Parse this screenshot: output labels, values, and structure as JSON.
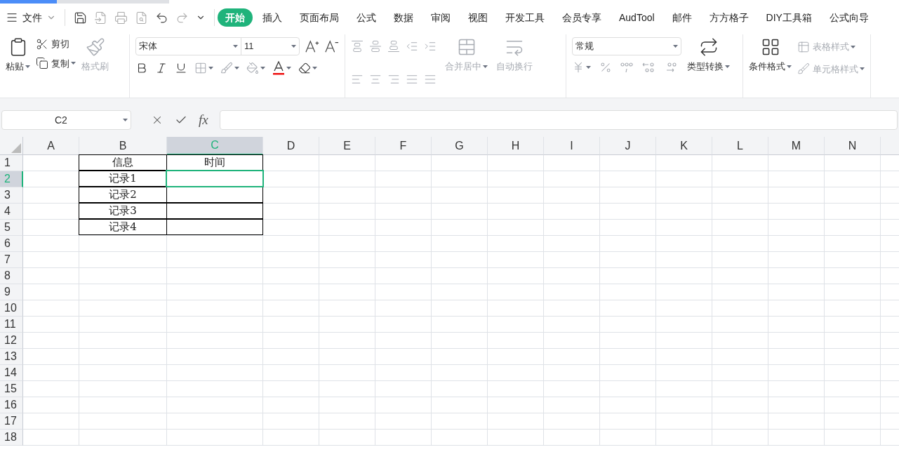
{
  "menu": {
    "file_label": "文件",
    "tabs": [
      {
        "label": "开始",
        "selected": true
      },
      {
        "label": "插入",
        "selected": false
      },
      {
        "label": "页面布局",
        "selected": false
      },
      {
        "label": "公式",
        "selected": false
      },
      {
        "label": "数据",
        "selected": false
      },
      {
        "label": "审阅",
        "selected": false
      },
      {
        "label": "视图",
        "selected": false
      },
      {
        "label": "开发工具",
        "selected": false
      },
      {
        "label": "会员专享",
        "selected": false
      },
      {
        "label": "AudTool",
        "selected": false
      },
      {
        "label": "邮件",
        "selected": false
      },
      {
        "label": "方方格子",
        "selected": false
      },
      {
        "label": "DIY工具箱",
        "selected": false
      },
      {
        "label": "公式向导",
        "selected": false
      }
    ]
  },
  "ribbon": {
    "clipboard": {
      "paste": {
        "label": "粘贴",
        "disabled": false
      },
      "cut": {
        "label": "剪切",
        "disabled": false
      },
      "copy": {
        "label": "复制",
        "disabled": false
      },
      "format_painter": {
        "label": "格式刷",
        "disabled": true
      }
    },
    "font": {
      "name": "宋体",
      "size": "11"
    },
    "alignment": {
      "merge": {
        "label": "合并居中",
        "disabled": true
      },
      "wrap": {
        "label": "自动换行",
        "disabled": true
      }
    },
    "number": {
      "format": "常规",
      "convert": {
        "label": "类型转换",
        "disabled": false
      }
    },
    "styles": {
      "conditional": {
        "label": "条件格式",
        "disabled": false
      },
      "table_style": {
        "label": "表格样式",
        "disabled": true
      },
      "cell_style": {
        "label": "单元格样式",
        "disabled": true
      }
    }
  },
  "name_box": "C2",
  "formula_bar": {
    "fx_label": "fx"
  },
  "sheet": {
    "columns": [
      {
        "label": "A",
        "selected": false
      },
      {
        "label": "B",
        "selected": false
      },
      {
        "label": "C",
        "selected": true
      },
      {
        "label": "D",
        "selected": false
      },
      {
        "label": "E",
        "selected": false
      },
      {
        "label": "F",
        "selected": false
      },
      {
        "label": "G",
        "selected": false
      },
      {
        "label": "H",
        "selected": false
      },
      {
        "label": "I",
        "selected": false
      },
      {
        "label": "J",
        "selected": false
      },
      {
        "label": "K",
        "selected": false
      },
      {
        "label": "L",
        "selected": false
      },
      {
        "label": "M",
        "selected": false
      },
      {
        "label": "N",
        "selected": false
      }
    ],
    "rows": [
      {
        "label": "1",
        "selected": false,
        "cells": [
          {
            "bordered": false,
            "selected": false
          },
          {
            "text": "信息",
            "bordered": true,
            "selected": false
          },
          {
            "text": "时间",
            "bordered": true,
            "selected": false
          }
        ]
      },
      {
        "label": "2",
        "selected": true,
        "cells": [
          {
            "bordered": false,
            "selected": false
          },
          {
            "text": "记录1",
            "bordered": true,
            "selected": false
          },
          {
            "bordered": true,
            "selected": true
          }
        ]
      },
      {
        "label": "3",
        "selected": false,
        "cells": [
          {
            "bordered": false,
            "selected": false
          },
          {
            "text": "记录2",
            "bordered": true,
            "selected": false
          },
          {
            "bordered": true,
            "selected": false
          }
        ]
      },
      {
        "label": "4",
        "selected": false,
        "cells": [
          {
            "bordered": false,
            "selected": false
          },
          {
            "text": "记录3",
            "bordered": true,
            "selected": false
          },
          {
            "bordered": true,
            "selected": false
          }
        ]
      },
      {
        "label": "5",
        "selected": false,
        "cells": [
          {
            "bordered": false,
            "selected": false
          },
          {
            "text": "记录4",
            "bordered": true,
            "selected": false
          },
          {
            "bordered": true,
            "selected": false
          }
        ]
      },
      {
        "label": "6",
        "selected": false,
        "cells": []
      },
      {
        "label": "7",
        "selected": false,
        "cells": []
      },
      {
        "label": "8",
        "selected": false,
        "cells": []
      },
      {
        "label": "9",
        "selected": false,
        "cells": []
      },
      {
        "label": "10",
        "selected": false,
        "cells": []
      },
      {
        "label": "11",
        "selected": false,
        "cells": []
      },
      {
        "label": "12",
        "selected": false,
        "cells": []
      },
      {
        "label": "13",
        "selected": false,
        "cells": []
      },
      {
        "label": "14",
        "selected": false,
        "cells": []
      },
      {
        "label": "15",
        "selected": false,
        "cells": []
      },
      {
        "label": "16",
        "selected": false,
        "cells": []
      },
      {
        "label": "17",
        "selected": false,
        "cells": []
      },
      {
        "label": "18",
        "selected": false,
        "cells": []
      }
    ]
  }
}
